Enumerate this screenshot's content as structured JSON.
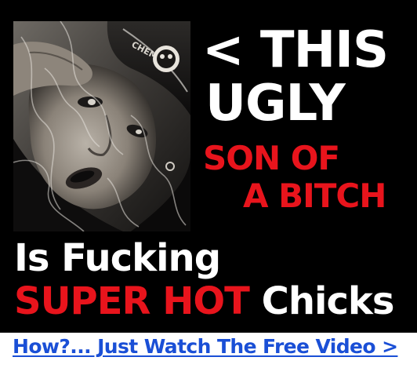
{
  "headline": {
    "pointer_line": "< THIS",
    "line2": "UGLY",
    "line3": "SON OF",
    "line4": "A BITCH"
  },
  "subline": {
    "line1": "Is Fucking",
    "highlight": "SUPER HOT",
    "rest": "Chicks"
  },
  "cta": {
    "label": "How?... Just Watch The Free Video >"
  },
  "photo": {
    "cap_text": "CHEMICAL"
  },
  "colors": {
    "background": "#000000",
    "accent_red": "#e8141c",
    "text_white": "#ffffff",
    "link_blue": "#1a4fd6"
  }
}
